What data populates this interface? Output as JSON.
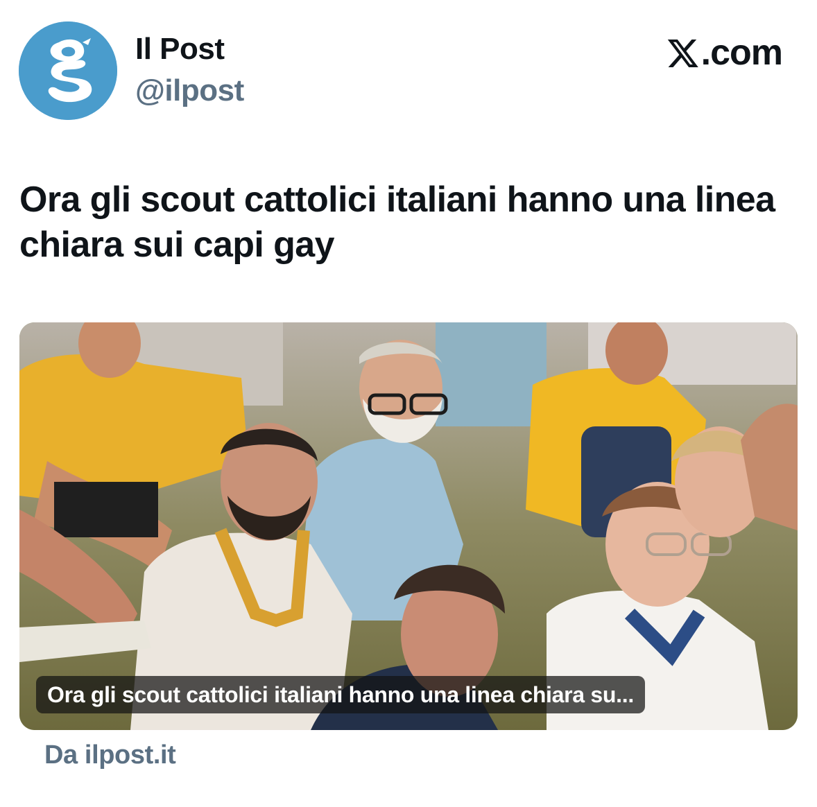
{
  "author": {
    "name": "Il Post",
    "handle": "@ilpost",
    "avatar_icon": "ilpost-logo-icon",
    "avatar_color": "#4a9ccc"
  },
  "brand": {
    "icon": "x-logo-icon",
    "text": ".com"
  },
  "headline": "Ora gli scout cattolici italiani hanno una linea chiara sui capi gay",
  "card": {
    "image_description_icon": "scouts-photo-image",
    "caption": "Ora gli scout cattolici italiani hanno una linea chiara su..."
  },
  "source": "Da ilpost.it",
  "colors": {
    "text_primary": "#0f1419",
    "text_secondary": "#5b7083",
    "background": "#ffffff"
  }
}
